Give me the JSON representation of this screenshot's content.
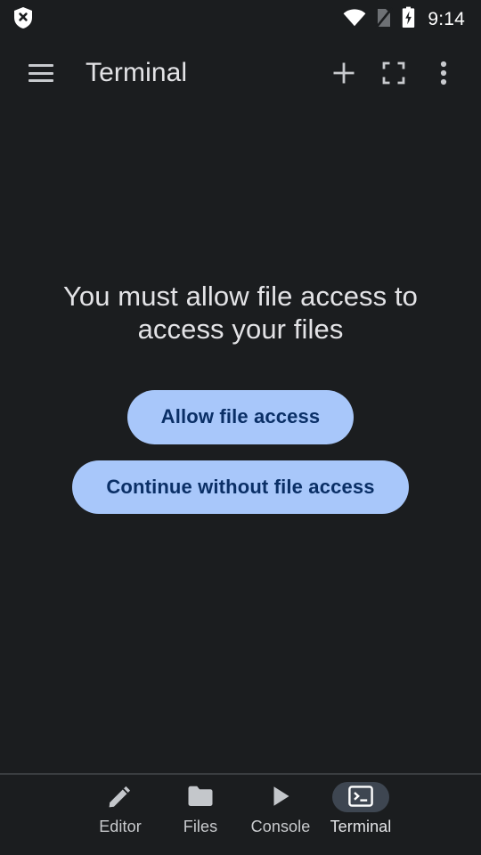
{
  "status_bar": {
    "left_icons": [
      {
        "name": "shield-x-icon",
        "label": "VPN disconnected"
      }
    ],
    "right_icons": [
      {
        "name": "wifi-icon",
        "label": "Wi-Fi full signal"
      },
      {
        "name": "no-sim-icon",
        "label": "No SIM card"
      },
      {
        "name": "battery-charging-icon",
        "label": "Battery charging"
      }
    ],
    "clock": "9:14"
  },
  "app_bar": {
    "menu_icon": "hamburger-menu-icon",
    "title": "Terminal",
    "actions": [
      {
        "name": "add-icon",
        "label": "New session"
      },
      {
        "name": "fullscreen-icon",
        "label": "Fullscreen"
      },
      {
        "name": "overflow-menu-icon",
        "label": "More options"
      }
    ]
  },
  "main": {
    "message": "You must allow file access to access your files",
    "buttons": [
      {
        "name": "allow-file-access-button",
        "label": "Allow file access"
      },
      {
        "name": "continue-without-file-access-button",
        "label": "Continue without file access"
      }
    ]
  },
  "bottom_nav": {
    "items": [
      {
        "label": "Editor",
        "icon": "pencil-icon",
        "selected": false
      },
      {
        "label": "Files",
        "icon": "folder-icon",
        "selected": false
      },
      {
        "label": "Console",
        "icon": "play-icon",
        "selected": false
      },
      {
        "label": "Terminal",
        "icon": "terminal-icon",
        "selected": true
      }
    ]
  },
  "colors": {
    "background": "#1b1d1f",
    "button_fill": "#a8c7fa",
    "button_text": "#0a2f66",
    "text_primary": "#e3e3e6",
    "nav_selected_pill": "#3e4651",
    "divider": "#3a3d40"
  }
}
